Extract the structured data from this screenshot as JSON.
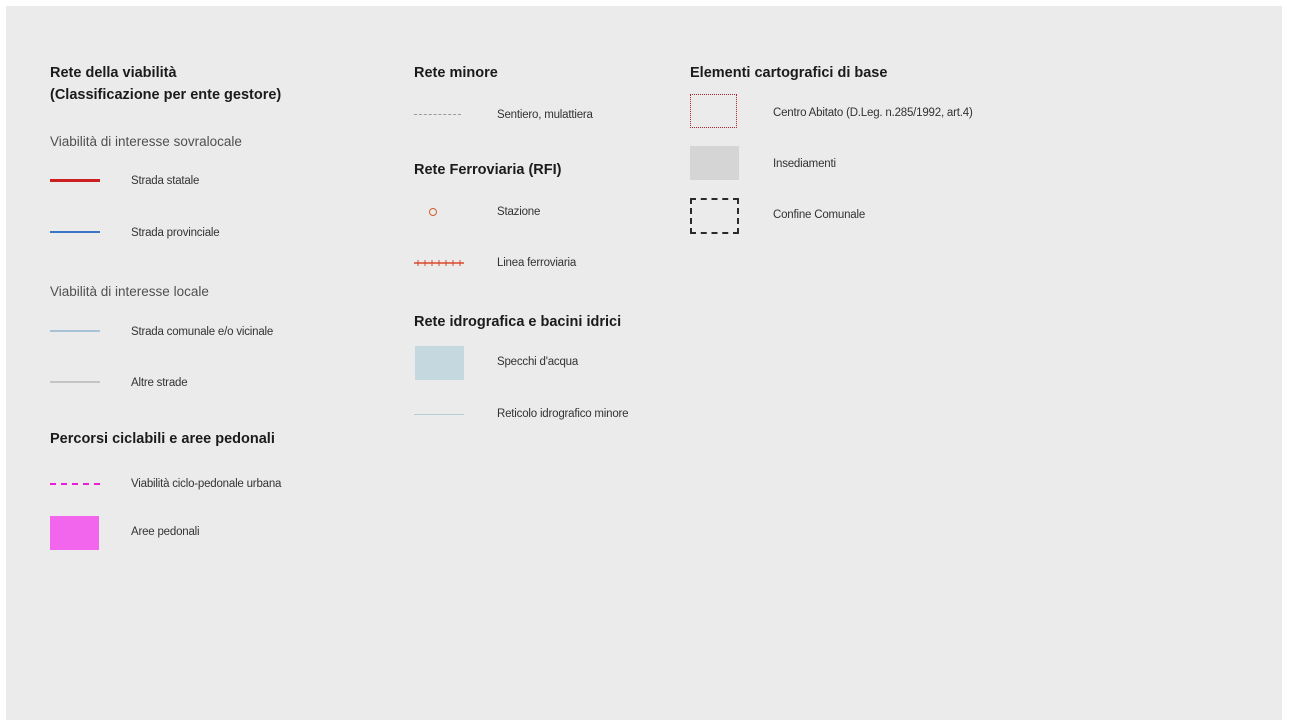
{
  "legend": {
    "col1": {
      "heading_line1": "Rete della viabilità",
      "heading_line2": "(Classificazione per ente gestore)",
      "group_sovralocale": "Viabilità di interesse sovralocale",
      "strada_statale": "Strada statale",
      "strada_provinciale": "Strada provinciale",
      "group_locale": "Viabilità di interesse locale",
      "strada_comunale": "Strada comunale e/o vicinale",
      "altre_strade": "Altre strade",
      "heading_ciclabili": "Percorsi ciclabili e aree pedonali",
      "ciclo_pedonale": "Viabilità ciclo-pedonale urbana",
      "aree_pedonali": "Aree pedonali"
    },
    "col2": {
      "heading_minore": "Rete minore",
      "sentiero": "Sentiero, mulattiera",
      "heading_ferroviaria": "Rete Ferroviaria (RFI)",
      "stazione": "Stazione",
      "linea_ferroviaria": "Linea ferroviaria",
      "heading_idrografica": "Rete idrografica e bacini idrici",
      "specchi_acqua": "Specchi d'acqua",
      "reticolo": "Reticolo idrografico minore"
    },
    "col3": {
      "heading_cartografici": "Elementi cartografici di base",
      "centro_abitato": "Centro Abitato (D.Leg. n.285/1992, art.4)",
      "insediamenti": "Insediamenti",
      "confine_comunale": "Confine Comunale"
    }
  },
  "colors": {
    "background": "#ebebeb",
    "strada_statale": "#cc1f1f",
    "strada_provinciale": "#3a76c6",
    "strada_comunale": "#a9c3d6",
    "altre_strade": "#c4c4c4",
    "ciclo_pedonale": "#e81fd6",
    "aree_pedonali": "#f266ee",
    "sentiero": "#9a9a9a",
    "stazione": "#d0602c",
    "linea_ferroviaria": "#d94a2c",
    "specchi_acqua": "#c5d8df",
    "reticolo": "#b5ccd9",
    "centro_abitato": "#b3252d",
    "insediamenti": "#d5d5d5",
    "confine_comunale": "#2a2a2a"
  }
}
